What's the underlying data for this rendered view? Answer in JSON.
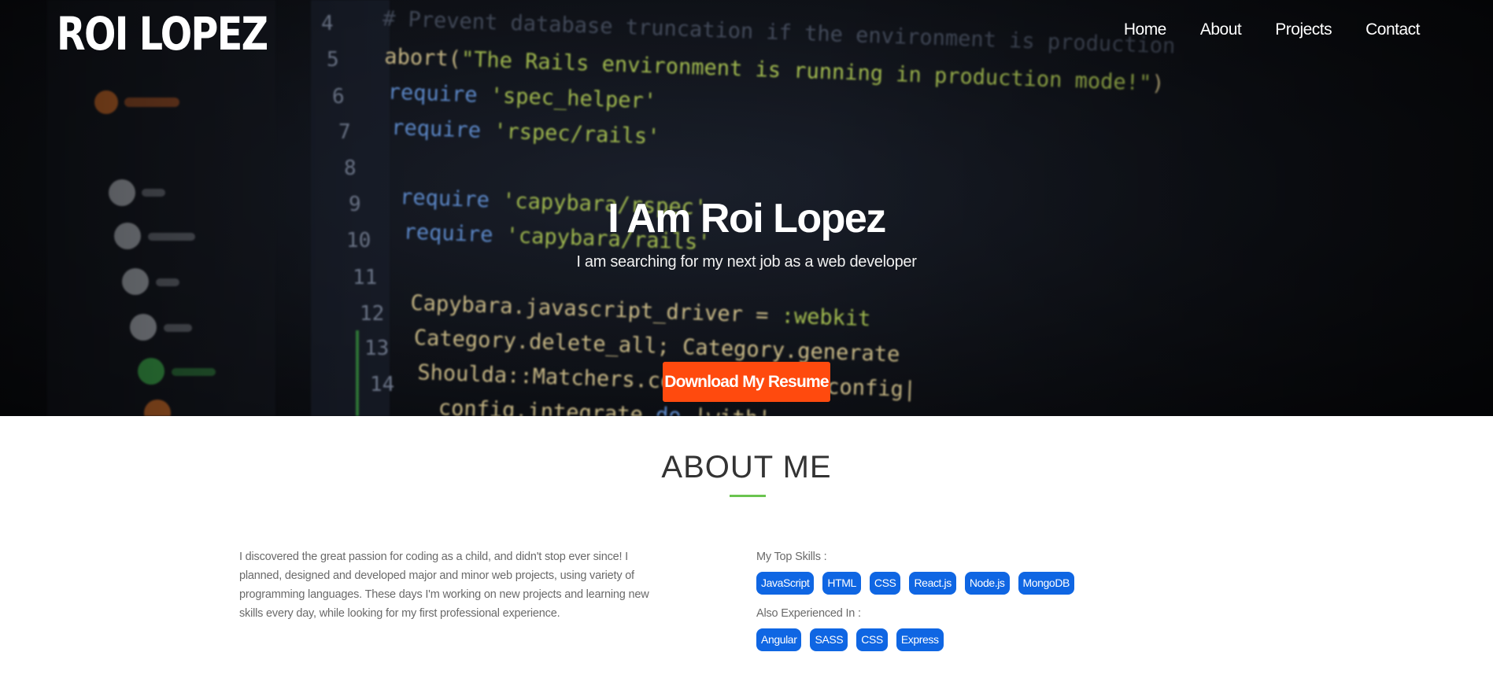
{
  "brand": {
    "name": "ROI LOPEZ"
  },
  "nav": {
    "items": [
      {
        "label": "Home"
      },
      {
        "label": "About"
      },
      {
        "label": "Projects"
      },
      {
        "label": "Contact"
      }
    ]
  },
  "hero": {
    "title": "I Am Roi Lopez",
    "subtitle": "I am searching for my next job as a web developer",
    "resume_button": "Download My Resume"
  },
  "about": {
    "title": "ABOUT ME",
    "bio": "I discovered the great passion for coding as a child, and didn't stop ever since! I planned, designed and developed major and minor web projects, using variety of programming languages. These days I'm working on new projects and learning new skills every day, while looking for my first professional experience.",
    "top_skills_label": "My Top Skills :",
    "top_skills": [
      "JavaScript",
      "HTML",
      "CSS",
      "React.js",
      "Node.js",
      "MongoDB"
    ],
    "also_label": "Also Experienced In :",
    "also_skills": [
      "Angular",
      "SASS",
      "CSS",
      "Express"
    ]
  },
  "colors": {
    "accent_button": "#ff4a0e",
    "skill_pill": "#0f66e3",
    "underline": "#6ac44f"
  }
}
